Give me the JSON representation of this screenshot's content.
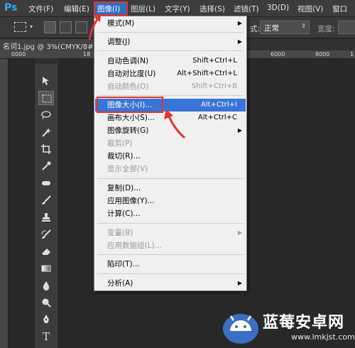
{
  "app": {
    "logo": "Ps"
  },
  "menubar": {
    "items": [
      "文件(F)",
      "编辑(E)",
      "图像(I)",
      "图层(L)",
      "文字(Y)",
      "选择(S)",
      "滤镜(T)",
      "3D(D)",
      "视图(V)",
      "窗口"
    ],
    "active": "图像(I)"
  },
  "options": {
    "mode_label": "式:",
    "mode_value": "正常",
    "width_label": "宽度:"
  },
  "document": {
    "tab_title": "名词1.jpg @ 3%(CMYK/8#"
  },
  "ruler": {
    "numbers": [
      "0000",
      "18",
      "6000",
      "8000",
      "1"
    ]
  },
  "menu": {
    "items": [
      {
        "label": "模式(M)",
        "shortcut": "",
        "submenu": true,
        "disabled": false
      },
      {
        "label": "调整(J)",
        "shortcut": "",
        "submenu": true,
        "disabled": false
      },
      {
        "label": "自动色调(N)",
        "shortcut": "Shift+Ctrl+L",
        "submenu": false,
        "disabled": false
      },
      {
        "label": "自动对比度(U)",
        "shortcut": "Alt+Shift+Ctrl+L",
        "submenu": false,
        "disabled": false
      },
      {
        "label": "自动颜色(O)",
        "shortcut": "Shift+Ctrl+B",
        "submenu": false,
        "disabled": true
      },
      {
        "label": "图像大小(I)...",
        "shortcut": "Alt+Ctrl+I",
        "submenu": false,
        "disabled": false,
        "highlighted": true
      },
      {
        "label": "画布大小(S)...",
        "shortcut": "Alt+Ctrl+C",
        "submenu": false,
        "disabled": false
      },
      {
        "label": "图像旋转(G)",
        "shortcut": "",
        "submenu": true,
        "disabled": false
      },
      {
        "label": "裁剪(P)",
        "shortcut": "",
        "submenu": false,
        "disabled": true
      },
      {
        "label": "裁切(R)...",
        "shortcut": "",
        "submenu": false,
        "disabled": false
      },
      {
        "label": "显示全部(V)",
        "shortcut": "",
        "submenu": false,
        "disabled": true
      },
      {
        "label": "复制(D)...",
        "shortcut": "",
        "submenu": false,
        "disabled": false
      },
      {
        "label": "应用图像(Y)...",
        "shortcut": "",
        "submenu": false,
        "disabled": false
      },
      {
        "label": "计算(C)...",
        "shortcut": "",
        "submenu": false,
        "disabled": false
      },
      {
        "label": "变量(B)",
        "shortcut": "",
        "submenu": true,
        "disabled": true
      },
      {
        "label": "应用数据组(L)...",
        "shortcut": "",
        "submenu": false,
        "disabled": true
      },
      {
        "label": "陷印(T)...",
        "shortcut": "",
        "submenu": false,
        "disabled": false
      },
      {
        "label": "分析(A)",
        "shortcut": "",
        "submenu": true,
        "disabled": false
      }
    ]
  },
  "watermark": {
    "title": "蓝莓安卓网",
    "url": "www.lmkjst.com"
  },
  "colors": {
    "highlight": "#3875d7",
    "annotation_red": "#e0342f",
    "ps_blue": "#31a8ff"
  }
}
